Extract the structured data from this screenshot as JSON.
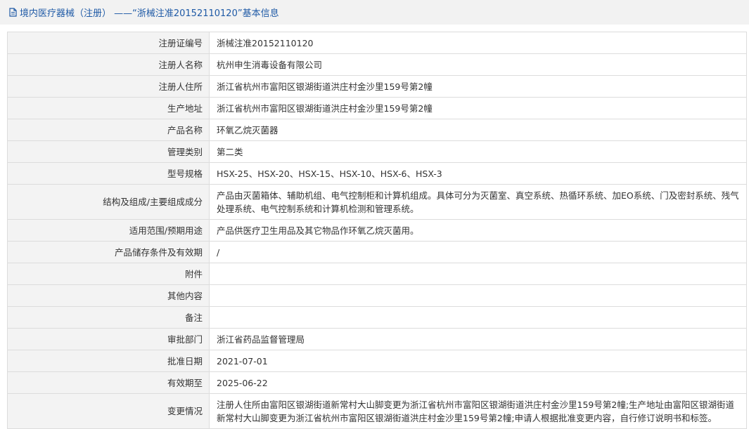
{
  "header": {
    "title": "境内医疗器械（注册） ——“浙械注准20152110120”基本信息",
    "icon": "document-icon"
  },
  "rows": [
    {
      "label": "注册证编号",
      "value": "浙械注准20152110120"
    },
    {
      "label": "注册人名称",
      "value": "杭州申生消毒设备有限公司"
    },
    {
      "label": "注册人住所",
      "value": "浙江省杭州市富阳区银湖街道洪庄村金沙里159号第2幢"
    },
    {
      "label": "生产地址",
      "value": "浙江省杭州市富阳区银湖街道洪庄村金沙里159号第2幢"
    },
    {
      "label": "产品名称",
      "value": "环氧乙烷灭菌器"
    },
    {
      "label": "管理类别",
      "value": "第二类"
    },
    {
      "label": "型号规格",
      "value": "HSX-25、HSX-20、HSX-15、HSX-10、HSX-6、HSX-3"
    },
    {
      "label": "结构及组成/主要组成成分",
      "value": "产品由灭菌箱体、辅助机组、电气控制柜和计算机组成。具体可分为灭菌室、真空系统、热循环系统、加EO系统、门及密封系统、残气处理系统、电气控制系统和计算机检测和管理系统。"
    },
    {
      "label": "适用范围/预期用途",
      "value": "产品供医疗卫生用品及其它物品作环氧乙烷灭菌用。"
    },
    {
      "label": "产品储存条件及有效期",
      "value": "/"
    },
    {
      "label": "附件",
      "value": ""
    },
    {
      "label": "其他内容",
      "value": ""
    },
    {
      "label": "备注",
      "value": ""
    },
    {
      "label": "审批部门",
      "value": "浙江省药品监督管理局"
    },
    {
      "label": "批准日期",
      "value": "2021-07-01"
    },
    {
      "label": "有效期至",
      "value": "2025-06-22"
    },
    {
      "label": "变更情况",
      "value": "注册人住所由富阳区银湖街道新常村大山脚变更为浙江省杭州市富阳区银湖街道洪庄村金沙里159号第2幢;生产地址由富阳区银湖街道新常村大山脚变更为浙江省杭州市富阳区银湖街道洪庄村金沙里159号第2幢;申请人根据批准变更内容，自行修订说明书和标签。"
    }
  ]
}
